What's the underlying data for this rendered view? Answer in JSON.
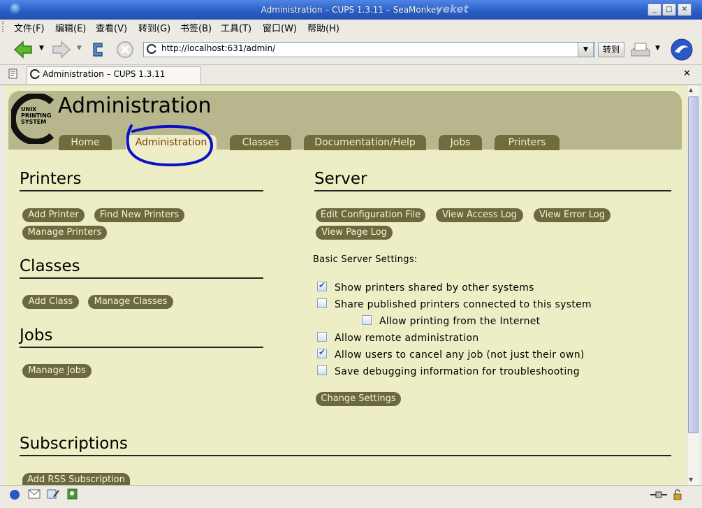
{
  "window": {
    "title": "Administration – CUPS 1.3.11 – SeaMonkey",
    "brand": "veket",
    "minimize": "_",
    "maximize": "□",
    "close": "✕"
  },
  "menus": [
    "文件(F)",
    "编辑(E)",
    "查看(V)",
    "转到(G)",
    "书签(B)",
    "工具(T)",
    "窗口(W)",
    "帮助(H)"
  ],
  "toolbar": {
    "url": "http://localhost:631/admin/",
    "goto_label": "转到",
    "dropdown_arrow": "▼"
  },
  "tab": {
    "title": "Administration – CUPS 1.3.11",
    "close": "✕"
  },
  "page": {
    "logo_text": "UNIX\nPRINTING\nSYSTEM",
    "heading": "Administration",
    "nav": [
      "Home",
      "Administration",
      "Classes",
      "Documentation/Help",
      "Jobs",
      "Printers"
    ],
    "active_nav": "Administration",
    "printers": {
      "heading": "Printers",
      "buttons": [
        "Add Printer",
        "Find New Printers",
        "Manage Printers"
      ]
    },
    "classes": {
      "heading": "Classes",
      "buttons": [
        "Add Class",
        "Manage Classes"
      ]
    },
    "jobs": {
      "heading": "Jobs",
      "buttons": [
        "Manage Jobs"
      ]
    },
    "server": {
      "heading": "Server",
      "buttons": [
        "Edit Configuration File",
        "View Access Log",
        "View Error Log",
        "View Page Log"
      ],
      "settings_label": "Basic Server Settings:",
      "settings": [
        {
          "label": "Show printers shared by other systems",
          "checked": true
        },
        {
          "label": "Share published printers connected to this system",
          "checked": false
        },
        {
          "label": "Allow printing from the Internet",
          "checked": false
        },
        {
          "label": "Allow remote administration",
          "checked": false
        },
        {
          "label": "Allow users to cancel any job (not just their own)",
          "checked": true
        },
        {
          "label": "Save debugging information for troubleshooting",
          "checked": false
        }
      ],
      "change_button": "Change Settings"
    },
    "subscriptions": {
      "heading": "Subscriptions",
      "buttons": [
        "Add RSS Subscription"
      ]
    }
  },
  "colors": {
    "header_band": "#b8b68c",
    "page_bg": "#eeeec6",
    "nav_tab": "#706c3e",
    "pill": "#6b6a3d",
    "annotation": "#0a12c8"
  }
}
